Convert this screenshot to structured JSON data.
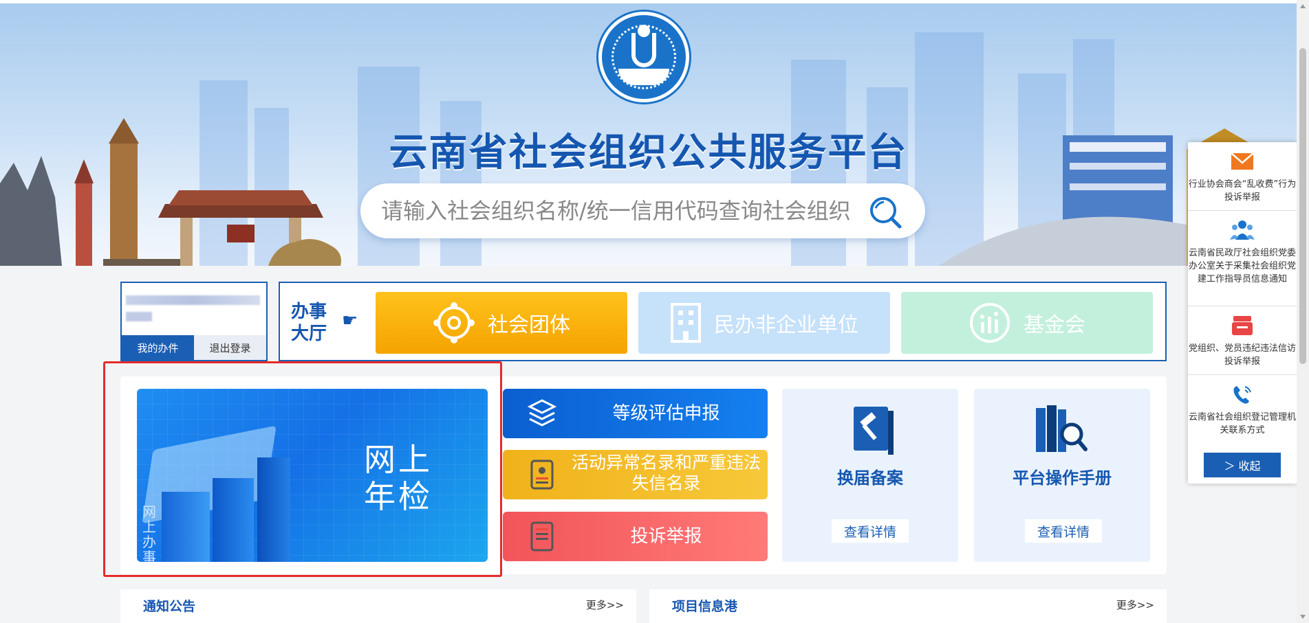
{
  "header": {
    "site_title": "云南省社会组织公共服务平台",
    "search_placeholder": "请输入社会组织名称/统一信用代码查询社会组织"
  },
  "user_panel": {
    "my_affairs": "我的办件",
    "logout": "退出登录"
  },
  "service_hall": {
    "label": "办事大厅",
    "buttons": [
      "社会团体",
      "民办非企业单位",
      "基金会"
    ]
  },
  "main": {
    "online_inspection": "网上年检",
    "online_vertical": "网上办事",
    "actions": [
      {
        "label": "等级评估申报"
      },
      {
        "label": "活动异常名录和严重违法失信名录"
      },
      {
        "label": "投诉举报"
      }
    ],
    "cards": [
      {
        "title": "换届备案",
        "button": "查看详情"
      },
      {
        "title": "平台操作手册",
        "button": "查看详情"
      }
    ]
  },
  "lower_sections": [
    {
      "title": "通知公告",
      "more": "更多>>"
    },
    {
      "title": "项目信息港",
      "more": "更多>>"
    }
  ],
  "float_panel": {
    "items": [
      {
        "icon": "envelope-icon",
        "text": "行业协会商会“乱收费”行为投诉举报"
      },
      {
        "icon": "people-icon",
        "text": "云南省民政厅社会组织党委办公室关于采集社会组织党建工作指导员信息通知"
      },
      {
        "icon": "mailbox-icon",
        "text": "党组织、党员违纪违法信访投诉举报"
      },
      {
        "icon": "phone-icon",
        "text": "云南省社会组织登记管理机关联系方式"
      }
    ],
    "collapse": "＞ 收起"
  },
  "colors": {
    "brand_blue": "#1557b0",
    "highlight_red": "#e52b2b",
    "yellow": "#f5a300",
    "red_action": "#f2545a"
  }
}
